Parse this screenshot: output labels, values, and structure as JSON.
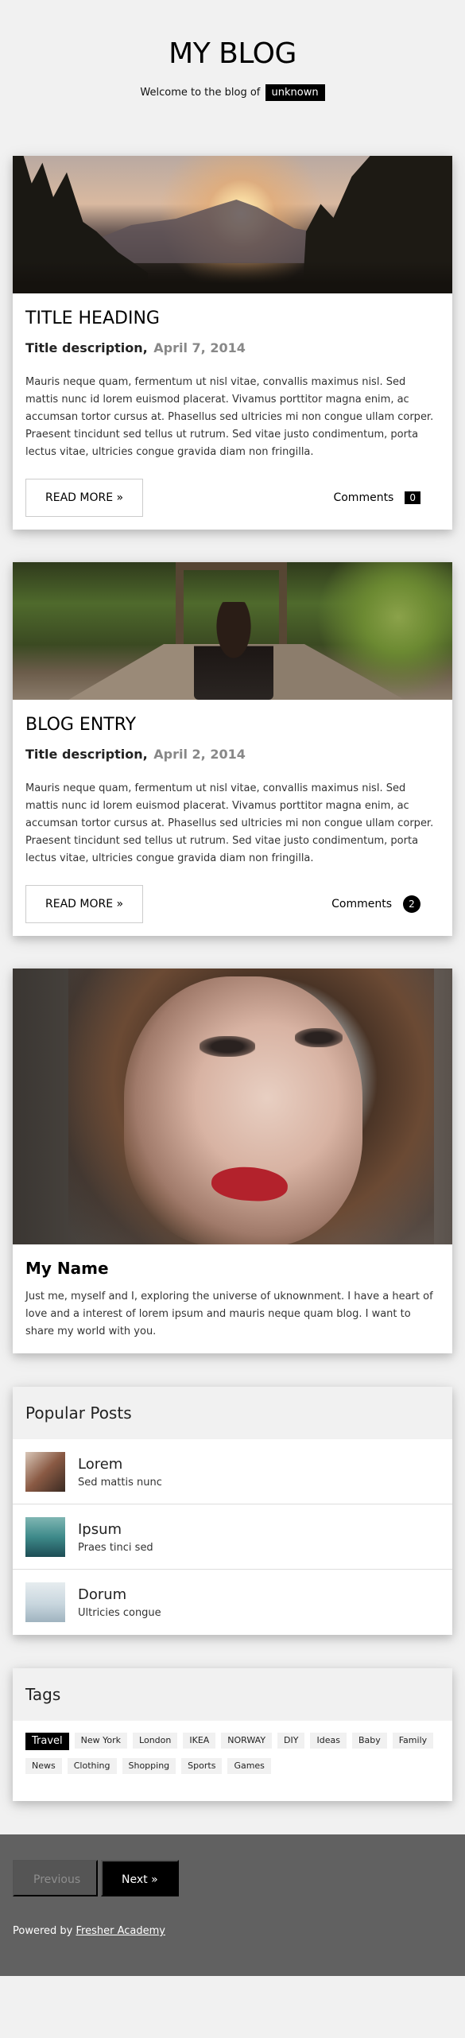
{
  "header": {
    "title": "MY BLOG",
    "welcome_text": "Welcome to the blog of",
    "username": "unknown"
  },
  "posts": [
    {
      "title": "TITLE HEADING",
      "subtitle": "Title description,",
      "date": "April 7, 2014",
      "body": "Mauris neque quam, fermentum ut nisl vitae, convallis maximus nisl. Sed mattis nunc id lorem euismod placerat. Vivamus porttitor magna enim, ac accumsan tortor cursus at. Phasellus sed ultricies mi non congue ullam corper. Praesent tincidunt sed tellus ut rutrum. Sed vitae justo condimentum, porta lectus vitae, ultricies congue gravida diam non fringilla.",
      "read_more": "READ MORE »",
      "comments_label": "Comments",
      "comments_count": "0"
    },
    {
      "title": "BLOG ENTRY",
      "subtitle": "Title description,",
      "date": "April 2, 2014",
      "body": "Mauris neque quam, fermentum ut nisl vitae, convallis maximus nisl. Sed mattis nunc id lorem euismod placerat. Vivamus porttitor magna enim, ac accumsan tortor cursus at. Phasellus sed ultricies mi non congue ullam corper. Praesent tincidunt sed tellus ut rutrum. Sed vitae justo condimentum, porta lectus vitae, ultricies congue gravida diam non fringilla.",
      "read_more": "READ MORE »",
      "comments_label": "Comments",
      "comments_count": "2"
    }
  ],
  "about": {
    "name": "My Name",
    "text": "Just me, myself and I, exploring the universe of uknownment. I have a heart of love and a interest of lorem ipsum and mauris neque quam blog. I want to share my world with you."
  },
  "popular": {
    "heading": "Popular Posts",
    "items": [
      {
        "title": "Lorem",
        "subtitle": "Sed mattis nunc"
      },
      {
        "title": "Ipsum",
        "subtitle": "Praes tinci sed"
      },
      {
        "title": "Dorum",
        "subtitle": "Ultricies congue"
      }
    ]
  },
  "tags": {
    "heading": "Tags",
    "items": [
      "Travel",
      "New York",
      "London",
      "IKEA",
      "NORWAY",
      "DIY",
      "Ideas",
      "Baby",
      "Family",
      "News",
      "Clothing",
      "Shopping",
      "Sports",
      "Games"
    ],
    "active": "Travel"
  },
  "footer": {
    "prev_label": "Previous",
    "next_label": "Next »",
    "powered_text": "Powered by",
    "powered_link": "Fresher Academy"
  },
  "colors": {
    "page_bg": "#f1f1f1",
    "footer_bg": "#616161",
    "accent": "#000000"
  }
}
